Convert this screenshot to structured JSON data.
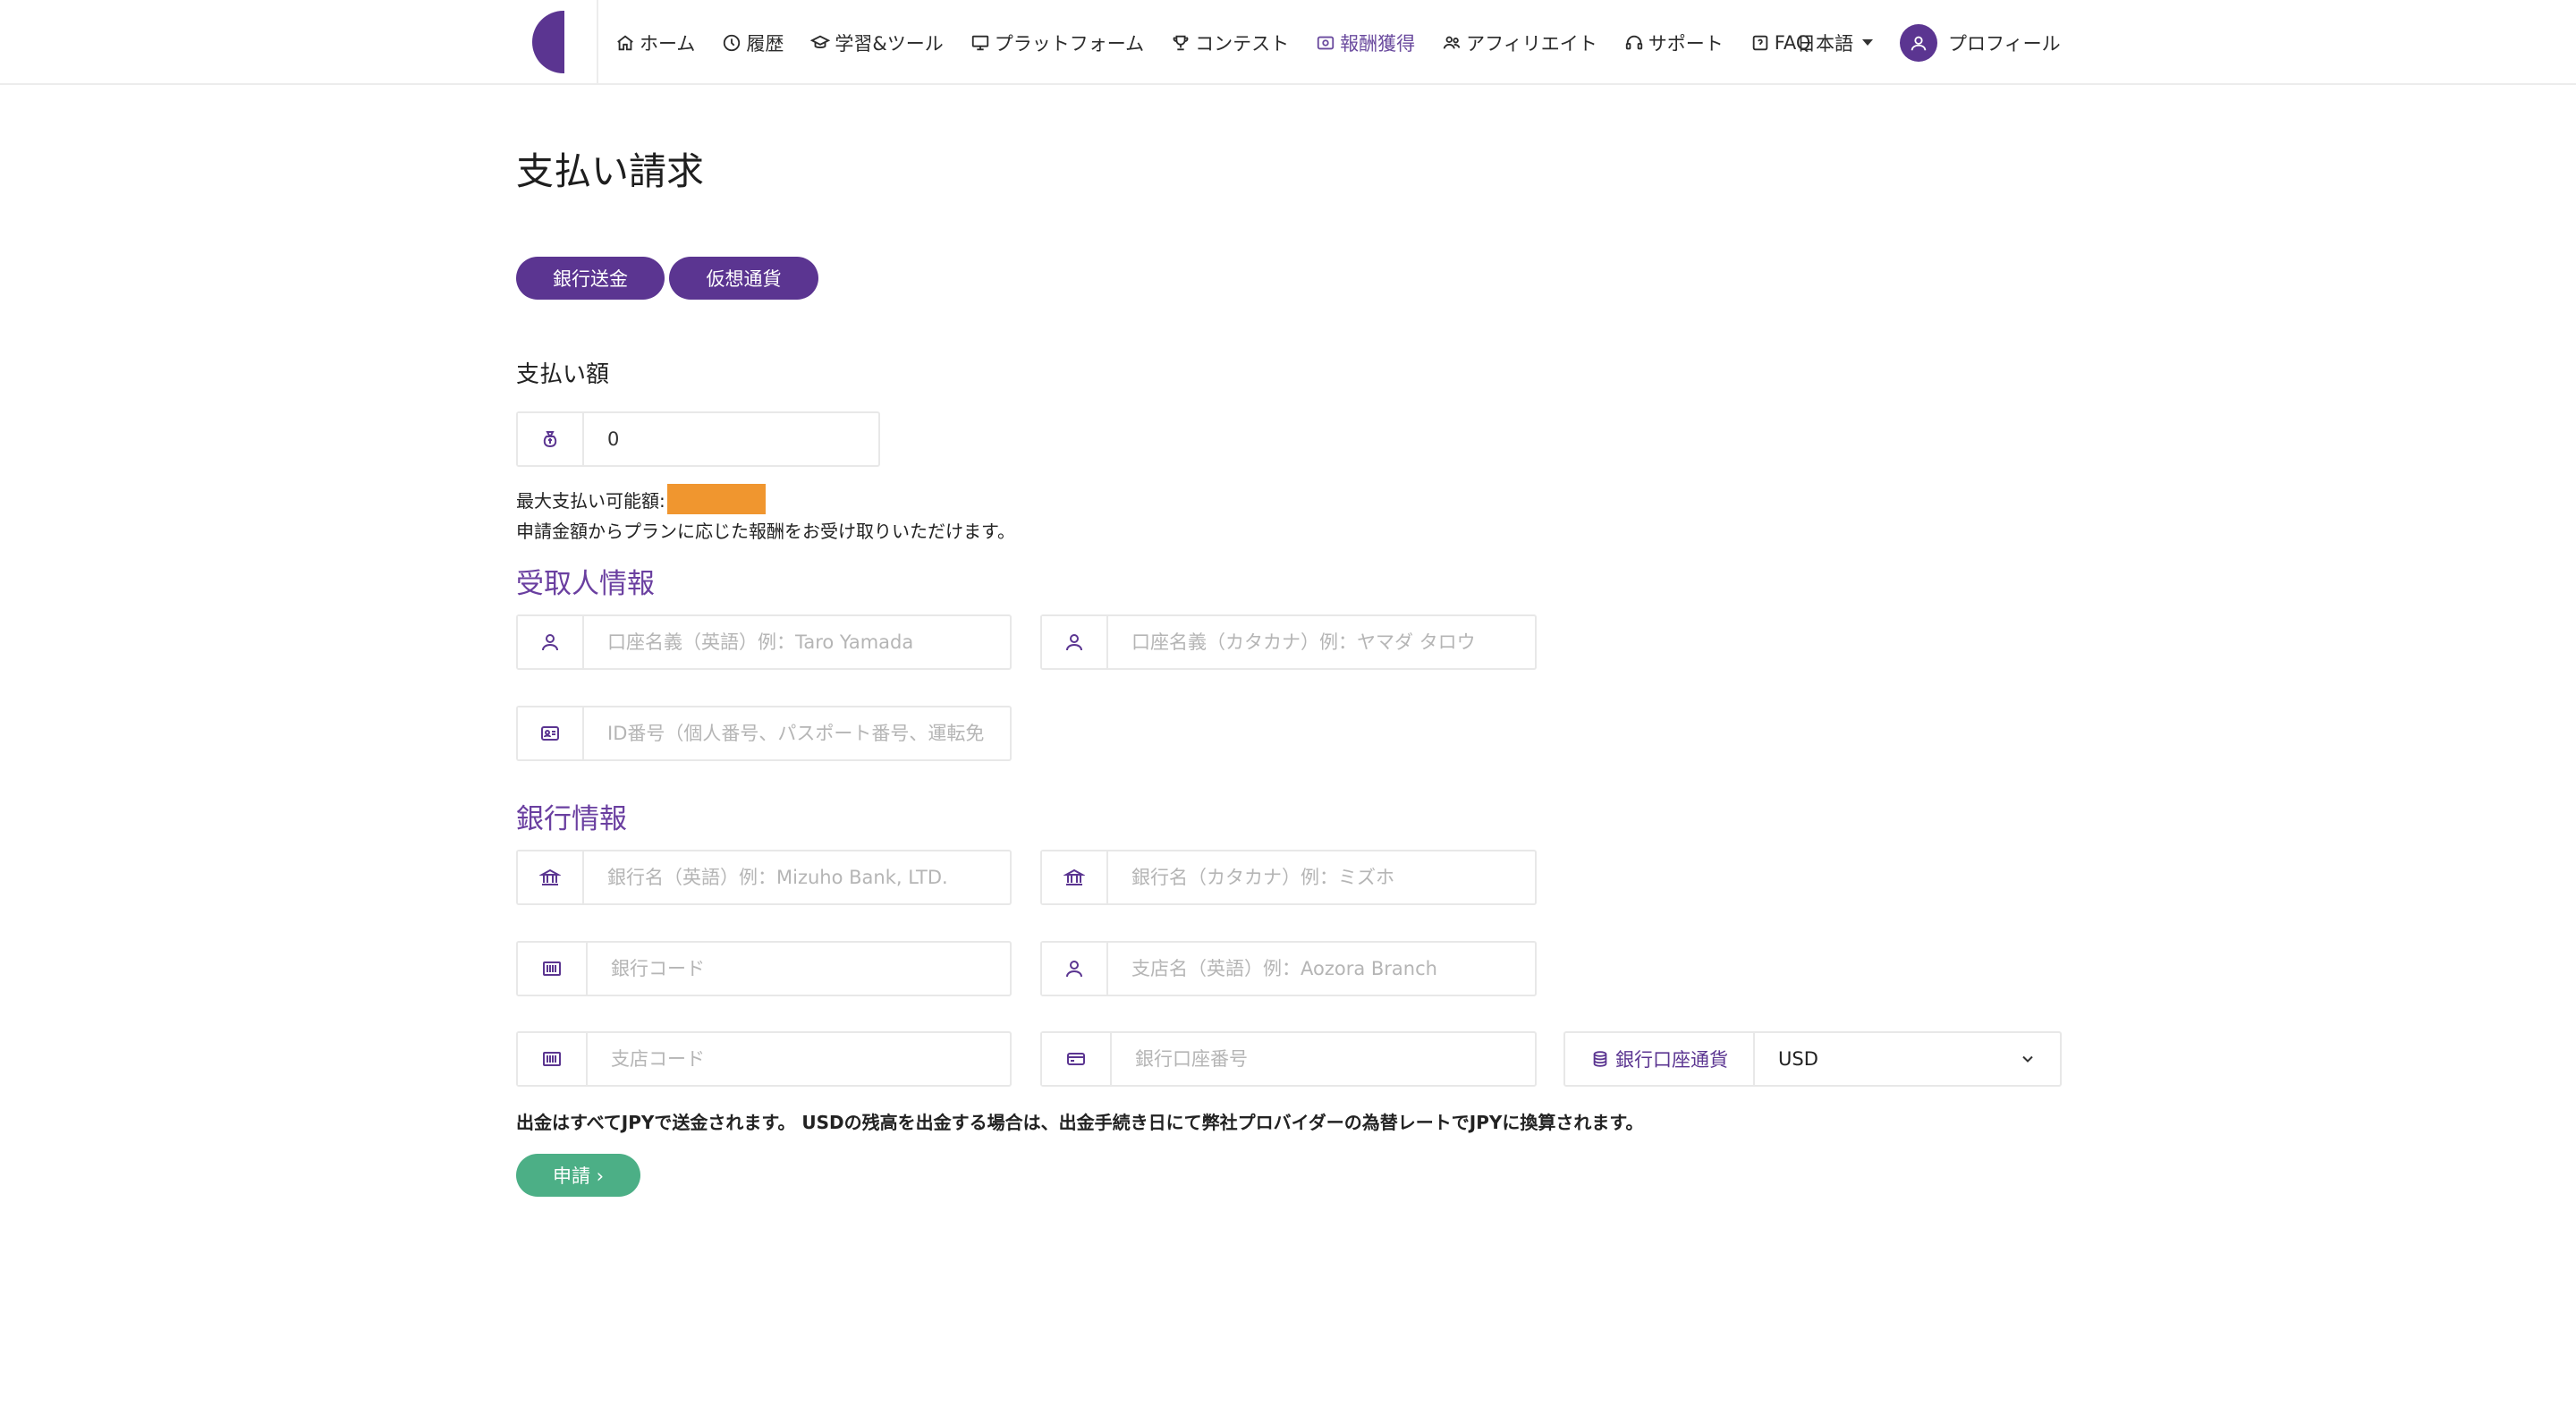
{
  "nav": {
    "items": [
      {
        "label": "ホーム",
        "icon": "home-icon",
        "active": false
      },
      {
        "label": "履歴",
        "icon": "clock-icon",
        "active": false
      },
      {
        "label": "学習&ツール",
        "icon": "graduation-cap-icon",
        "active": false
      },
      {
        "label": "プラットフォーム",
        "icon": "monitor-icon",
        "active": false
      },
      {
        "label": "コンテスト",
        "icon": "trophy-icon",
        "active": false
      },
      {
        "label": "報酬獲得",
        "icon": "reward-icon",
        "active": true
      },
      {
        "label": "アフィリエイト",
        "icon": "users-icon",
        "active": false
      },
      {
        "label": "サポート",
        "icon": "headset-icon",
        "active": false
      },
      {
        "label": "FAQ",
        "icon": "question-icon",
        "active": false
      }
    ],
    "language": "日本語",
    "profile": "プロフィール"
  },
  "page": {
    "title": "支払い請求",
    "tabs": [
      "銀行送金",
      "仮想通貨"
    ],
    "amount_label": "支払い額",
    "amount_value": "0",
    "max_label": "最大支払い可能額:",
    "note": "申請金額からプランに応じた報酬をお受け取りいただけます。"
  },
  "recipient": {
    "heading": "受取人情報",
    "name_en_placeholder": "口座名義（英語）例：Taro Yamada",
    "name_kana_placeholder": "口座名義（カタカナ）例：ヤマダ タロウ",
    "id_placeholder": "ID番号（個人番号、パスポート番号、運転免"
  },
  "bank": {
    "heading": "銀行情報",
    "bank_en_placeholder": "銀行名（英語）例：Mizuho Bank, LTD.",
    "bank_kana_placeholder": "銀行名（カタカナ）例：ミズホ",
    "bank_code_placeholder": "銀行コード",
    "branch_en_placeholder": "支店名（英語）例：Aozora Branch",
    "branch_code_placeholder": "支店コード",
    "account_number_placeholder": "銀行口座番号",
    "currency_label": "銀行口座通貨",
    "currency_value": "USD"
  },
  "fx_note": "出金はすべてJPYで送金されます。 USDの残高を出金する場合は、出金手続き日にて弊社プロバイダーの為替レートでJPYに換算されます。",
  "submit_label": "申請 ›",
  "colors": {
    "brand": "#5b3591",
    "active_nav": "#6a4a9e",
    "submit": "#4caf86",
    "redaction": "#f0962f"
  }
}
